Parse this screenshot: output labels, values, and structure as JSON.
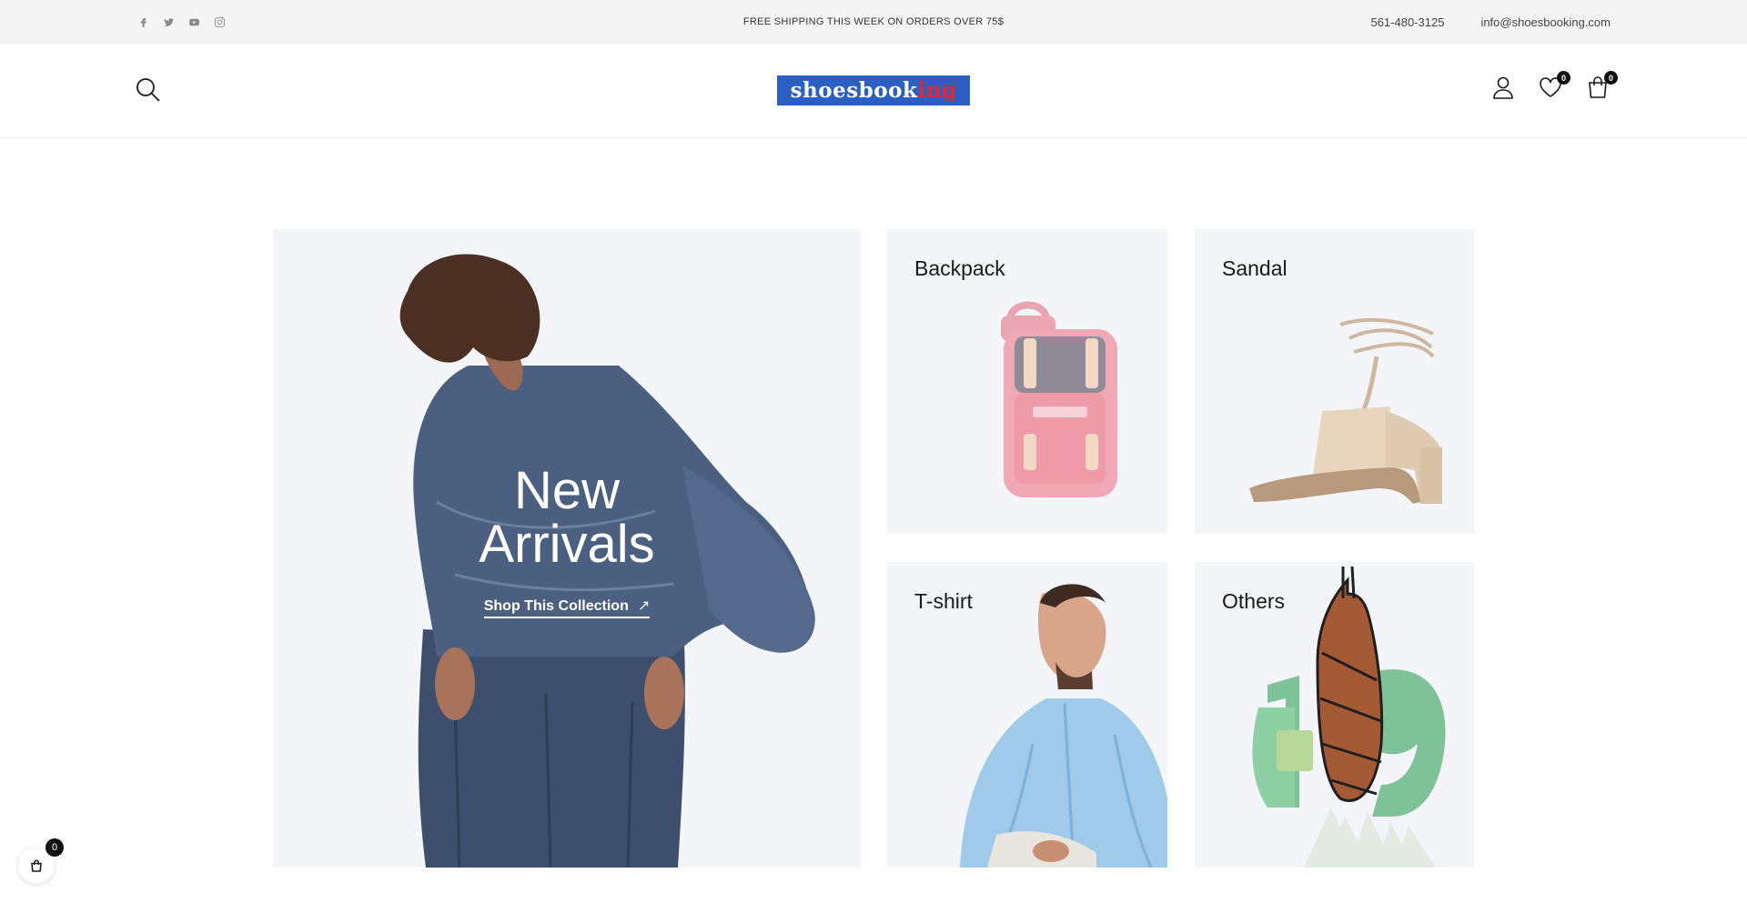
{
  "topbar": {
    "social": [
      "facebook-icon",
      "twitter-icon",
      "youtube-icon",
      "instagram-icon"
    ],
    "promo": "FREE SHIPPING THIS WEEK ON ORDERS OVER 75$",
    "phone": "561-480-3125",
    "email": "info@shoesbooking.com"
  },
  "header": {
    "logo_main": "shoesbook",
    "logo_accent": "ing",
    "wishlist_count": "0",
    "cart_count": "0"
  },
  "hero": {
    "title_line1": "New",
    "title_line2": "Arrivals",
    "link_label": "Shop This Collection",
    "link_arrow": "↗"
  },
  "collections": [
    {
      "title": "Backpack"
    },
    {
      "title": "Sandal"
    },
    {
      "title": "T-shirt"
    },
    {
      "title": "Others"
    }
  ],
  "float_cart": {
    "count": "0"
  },
  "colors": {
    "logo_bg": "#2b5fc4",
    "logo_accent": "#e8262d",
    "tile_bg": "#f3f5f8",
    "badge": "#111111"
  }
}
